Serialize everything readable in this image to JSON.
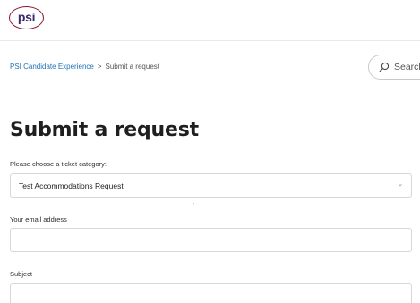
{
  "header": {
    "logo_text": "psi",
    "brand_color": "#8b1538",
    "logo_text_color": "#3d2a6e"
  },
  "breadcrumb": {
    "home": "PSI Candidate Experience",
    "separator": ">",
    "current": "Submit a request",
    "link_color": "#1f73b7"
  },
  "search": {
    "placeholder": "Search",
    "icon": "search-icon"
  },
  "page": {
    "title": "Submit a request"
  },
  "form": {
    "category": {
      "label": "Please choose a ticket category:",
      "value": "Test Accommodations Request",
      "icon": "chevron-down-icon"
    },
    "email": {
      "label": "Your email address",
      "value": ""
    },
    "subject": {
      "label": "Subject",
      "value": ""
    }
  }
}
